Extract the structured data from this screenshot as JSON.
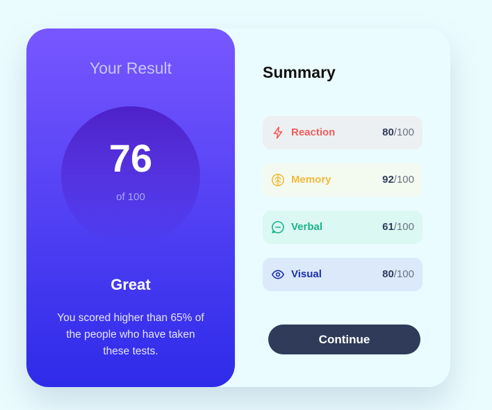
{
  "result": {
    "heading": "Your Result",
    "score": "76",
    "out_of": "of 100",
    "rating": "Great",
    "description": "You scored higher than 65% of the people who have taken these tests."
  },
  "summary": {
    "heading": "Summary",
    "items": [
      {
        "label": "Reaction",
        "score": "80",
        "max": "/100",
        "icon": "lightning-icon",
        "color": "#f25c5c",
        "bg": "#edf0f2"
      },
      {
        "label": "Memory",
        "score": "92",
        "max": "/100",
        "icon": "brain-icon",
        "color": "#f4b93b",
        "bg": "#f3fbf1"
      },
      {
        "label": "Verbal",
        "score": "61",
        "max": "/100",
        "icon": "chat-icon",
        "color": "#1bb38a",
        "bg": "#dbf8f2"
      },
      {
        "label": "Visual",
        "score": "80",
        "max": "/100",
        "icon": "eye-icon",
        "color": "#1d2fa8",
        "bg": "#dbe9fb"
      }
    ]
  },
  "actions": {
    "continue_label": "Continue"
  },
  "colors": {
    "page_background": "#ebfcff",
    "gradient_top": "#7857ff",
    "gradient_bottom": "#2e2be9",
    "button": "#303b5a"
  }
}
